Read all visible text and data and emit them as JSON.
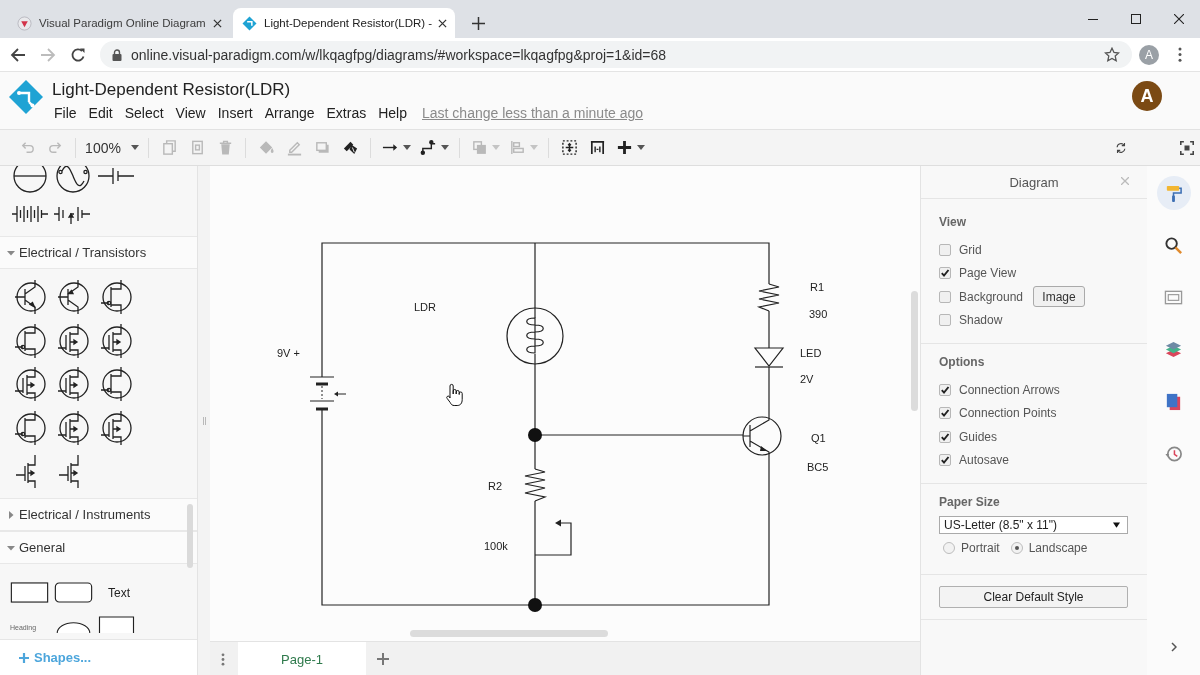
{
  "browser": {
    "tabs": [
      {
        "title": "Visual Paradigm Online Diagram",
        "selected": false
      },
      {
        "title": "Light-Dependent Resistor(LDR) -",
        "selected": true
      }
    ],
    "forward_disabled": true,
    "url": "online.visual-paradigm.com/w/lkqagfpg/diagrams/#workspace=lkqagfpg&proj=1&id=68",
    "profile_initial": "A"
  },
  "app": {
    "title": "Light-Dependent Resistor(LDR)",
    "menu": [
      "File",
      "Edit",
      "Select",
      "View",
      "Insert",
      "Arrange",
      "Extras",
      "Help"
    ],
    "last_change": "Last change less than a minute ago",
    "user_initial": "A"
  },
  "toolbar": {
    "groups": [
      [
        {
          "kind": "undo",
          "disabled": true
        },
        {
          "kind": "redo",
          "disabled": true
        }
      ],
      [
        {
          "kind": "zoom",
          "label": "100%"
        }
      ],
      [
        {
          "kind": "copy",
          "disabled": true
        },
        {
          "kind": "paste",
          "disabled": true
        },
        {
          "kind": "delete",
          "disabled": true
        }
      ],
      [
        {
          "kind": "fill",
          "disabled": true
        },
        {
          "kind": "line-color",
          "disabled": true
        },
        {
          "kind": "shadow",
          "disabled": true
        },
        {
          "kind": "format-painter",
          "disabled": false
        }
      ],
      [
        {
          "kind": "connector",
          "disabled": false,
          "dropdown": true
        },
        {
          "kind": "waypoint",
          "disabled": false,
          "dropdown": true
        }
      ],
      [
        {
          "kind": "to-front",
          "disabled": true,
          "dropdown": true
        },
        {
          "kind": "align",
          "disabled": true,
          "dropdown": true
        }
      ],
      [
        {
          "kind": "select-all",
          "disabled": false
        },
        {
          "kind": "fit",
          "disabled": false
        },
        {
          "kind": "insert",
          "disabled": false,
          "dropdown": true
        }
      ]
    ],
    "right": [
      {
        "kind": "refresh"
      },
      {
        "kind": "fullscreen"
      }
    ]
  },
  "sidebar": {
    "sections": [
      {
        "kind": "sources"
      },
      {
        "kind": "transistors",
        "title": "Electrical / Transistors",
        "expanded": true
      },
      {
        "title": "Electrical / Instruments",
        "expanded": false
      },
      {
        "kind": "general",
        "title": "General",
        "expanded": true,
        "labels": [
          "Text",
          "Heading"
        ]
      }
    ],
    "more_shapes": "Shapes..."
  },
  "canvas": {
    "components": [
      {
        "kind": "ldr",
        "name": "LDR"
      },
      {
        "kind": "battery",
        "name": "9V +"
      },
      {
        "kind": "resistor",
        "name": "R1",
        "value": "390"
      },
      {
        "kind": "led",
        "name": "LED",
        "value": "2V"
      },
      {
        "kind": "transistor",
        "name": "Q1",
        "value": "BC5"
      },
      {
        "kind": "potentiometer",
        "name": "R2",
        "value": "100k"
      }
    ]
  },
  "pages": [
    {
      "label": "Page-1",
      "selected": true
    }
  ],
  "panel": {
    "title": "Diagram",
    "sections": [
      {
        "heading": "View",
        "options": [
          {
            "label": "Grid",
            "checked": false
          },
          {
            "label": "Page View",
            "checked": true
          },
          {
            "label": "Background",
            "checked": false,
            "button": "Image"
          },
          {
            "label": "Shadow",
            "checked": false
          }
        ]
      },
      {
        "heading": "Options",
        "options": [
          {
            "label": "Connection Arrows",
            "checked": true
          },
          {
            "label": "Connection Points",
            "checked": true
          },
          {
            "label": "Guides",
            "checked": true
          },
          {
            "label": "Autosave",
            "checked": true
          }
        ]
      }
    ],
    "paper_size": {
      "heading": "Paper Size",
      "value": "US-Letter (8.5\" x 11\")",
      "orientations": [
        {
          "label": "Portrait",
          "selected": false
        },
        {
          "label": "Landscape",
          "selected": true
        }
      ]
    },
    "reset_button": "Clear Default Style"
  },
  "side_icons": [
    {
      "kind": "format",
      "selected": true
    },
    {
      "kind": "search",
      "selected": false
    },
    {
      "kind": "outline",
      "selected": false
    },
    {
      "kind": "layers",
      "selected": false
    },
    {
      "kind": "pages",
      "selected": false
    },
    {
      "kind": "history",
      "selected": false
    }
  ]
}
